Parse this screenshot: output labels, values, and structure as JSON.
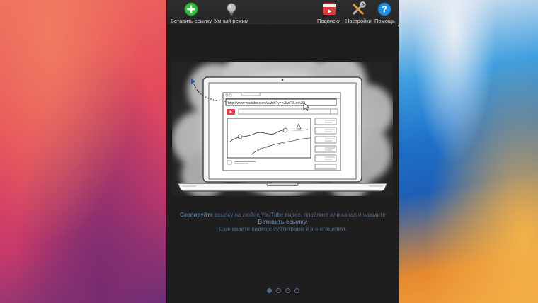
{
  "toolbar": {
    "paste_label": "Вставить ссылку",
    "smart_label": "Умный режим",
    "subscriptions_label": "Подписки",
    "settings_label": "Настройки",
    "help_label": "Помощь"
  },
  "icons": {
    "paste": "plus-circle-icon",
    "smart": "lightbulb-icon",
    "subscriptions": "youtube-subscriptions-icon",
    "settings": "tools-icon",
    "help": "question-circle-icon"
  },
  "colors": {
    "paste_green": "#2fbf3a",
    "help_blue": "#1e8fe6",
    "subs_red": "#d83b3b",
    "text_blue": "#4f6b8a"
  },
  "illustration": {
    "url_text": "http://www.youtube.com/watch?v=nJkwF9LmhJQ"
  },
  "description": {
    "copy_bold": "Скопируйте",
    "line1_rest": " ссылку на любое YouTube видео, плейлист или канал и нажмите",
    "paste_bold": "Вставить ссылку.",
    "line3": "Скачивайте видео с субтитрами и аннотациями."
  },
  "pager": {
    "count": 4,
    "active_index": 0
  }
}
